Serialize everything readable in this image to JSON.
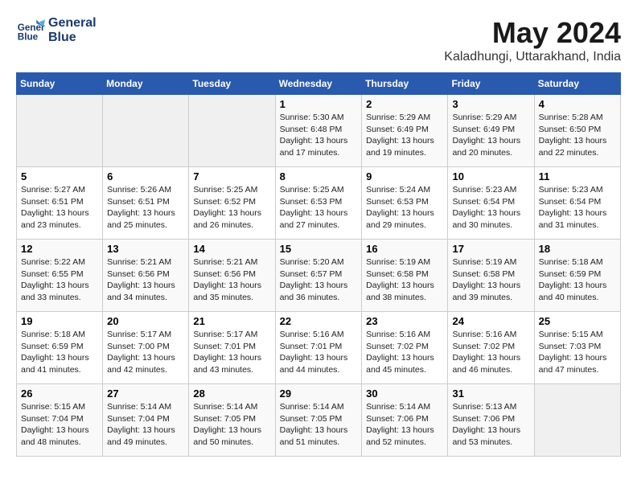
{
  "logo": {
    "line1": "General",
    "line2": "Blue"
  },
  "title": "May 2024",
  "location": "Kaladhungi, Uttarakhand, India",
  "days_of_week": [
    "Sunday",
    "Monday",
    "Tuesday",
    "Wednesday",
    "Thursday",
    "Friday",
    "Saturday"
  ],
  "weeks": [
    [
      {
        "num": "",
        "info": ""
      },
      {
        "num": "",
        "info": ""
      },
      {
        "num": "",
        "info": ""
      },
      {
        "num": "1",
        "info": "Sunrise: 5:30 AM\nSunset: 6:48 PM\nDaylight: 13 hours\nand 17 minutes."
      },
      {
        "num": "2",
        "info": "Sunrise: 5:29 AM\nSunset: 6:49 PM\nDaylight: 13 hours\nand 19 minutes."
      },
      {
        "num": "3",
        "info": "Sunrise: 5:29 AM\nSunset: 6:49 PM\nDaylight: 13 hours\nand 20 minutes."
      },
      {
        "num": "4",
        "info": "Sunrise: 5:28 AM\nSunset: 6:50 PM\nDaylight: 13 hours\nand 22 minutes."
      }
    ],
    [
      {
        "num": "5",
        "info": "Sunrise: 5:27 AM\nSunset: 6:51 PM\nDaylight: 13 hours\nand 23 minutes."
      },
      {
        "num": "6",
        "info": "Sunrise: 5:26 AM\nSunset: 6:51 PM\nDaylight: 13 hours\nand 25 minutes."
      },
      {
        "num": "7",
        "info": "Sunrise: 5:25 AM\nSunset: 6:52 PM\nDaylight: 13 hours\nand 26 minutes."
      },
      {
        "num": "8",
        "info": "Sunrise: 5:25 AM\nSunset: 6:53 PM\nDaylight: 13 hours\nand 27 minutes."
      },
      {
        "num": "9",
        "info": "Sunrise: 5:24 AM\nSunset: 6:53 PM\nDaylight: 13 hours\nand 29 minutes."
      },
      {
        "num": "10",
        "info": "Sunrise: 5:23 AM\nSunset: 6:54 PM\nDaylight: 13 hours\nand 30 minutes."
      },
      {
        "num": "11",
        "info": "Sunrise: 5:23 AM\nSunset: 6:54 PM\nDaylight: 13 hours\nand 31 minutes."
      }
    ],
    [
      {
        "num": "12",
        "info": "Sunrise: 5:22 AM\nSunset: 6:55 PM\nDaylight: 13 hours\nand 33 minutes."
      },
      {
        "num": "13",
        "info": "Sunrise: 5:21 AM\nSunset: 6:56 PM\nDaylight: 13 hours\nand 34 minutes."
      },
      {
        "num": "14",
        "info": "Sunrise: 5:21 AM\nSunset: 6:56 PM\nDaylight: 13 hours\nand 35 minutes."
      },
      {
        "num": "15",
        "info": "Sunrise: 5:20 AM\nSunset: 6:57 PM\nDaylight: 13 hours\nand 36 minutes."
      },
      {
        "num": "16",
        "info": "Sunrise: 5:19 AM\nSunset: 6:58 PM\nDaylight: 13 hours\nand 38 minutes."
      },
      {
        "num": "17",
        "info": "Sunrise: 5:19 AM\nSunset: 6:58 PM\nDaylight: 13 hours\nand 39 minutes."
      },
      {
        "num": "18",
        "info": "Sunrise: 5:18 AM\nSunset: 6:59 PM\nDaylight: 13 hours\nand 40 minutes."
      }
    ],
    [
      {
        "num": "19",
        "info": "Sunrise: 5:18 AM\nSunset: 6:59 PM\nDaylight: 13 hours\nand 41 minutes."
      },
      {
        "num": "20",
        "info": "Sunrise: 5:17 AM\nSunset: 7:00 PM\nDaylight: 13 hours\nand 42 minutes."
      },
      {
        "num": "21",
        "info": "Sunrise: 5:17 AM\nSunset: 7:01 PM\nDaylight: 13 hours\nand 43 minutes."
      },
      {
        "num": "22",
        "info": "Sunrise: 5:16 AM\nSunset: 7:01 PM\nDaylight: 13 hours\nand 44 minutes."
      },
      {
        "num": "23",
        "info": "Sunrise: 5:16 AM\nSunset: 7:02 PM\nDaylight: 13 hours\nand 45 minutes."
      },
      {
        "num": "24",
        "info": "Sunrise: 5:16 AM\nSunset: 7:02 PM\nDaylight: 13 hours\nand 46 minutes."
      },
      {
        "num": "25",
        "info": "Sunrise: 5:15 AM\nSunset: 7:03 PM\nDaylight: 13 hours\nand 47 minutes."
      }
    ],
    [
      {
        "num": "26",
        "info": "Sunrise: 5:15 AM\nSunset: 7:04 PM\nDaylight: 13 hours\nand 48 minutes."
      },
      {
        "num": "27",
        "info": "Sunrise: 5:14 AM\nSunset: 7:04 PM\nDaylight: 13 hours\nand 49 minutes."
      },
      {
        "num": "28",
        "info": "Sunrise: 5:14 AM\nSunset: 7:05 PM\nDaylight: 13 hours\nand 50 minutes."
      },
      {
        "num": "29",
        "info": "Sunrise: 5:14 AM\nSunset: 7:05 PM\nDaylight: 13 hours\nand 51 minutes."
      },
      {
        "num": "30",
        "info": "Sunrise: 5:14 AM\nSunset: 7:06 PM\nDaylight: 13 hours\nand 52 minutes."
      },
      {
        "num": "31",
        "info": "Sunrise: 5:13 AM\nSunset: 7:06 PM\nDaylight: 13 hours\nand 53 minutes."
      },
      {
        "num": "",
        "info": ""
      }
    ]
  ]
}
